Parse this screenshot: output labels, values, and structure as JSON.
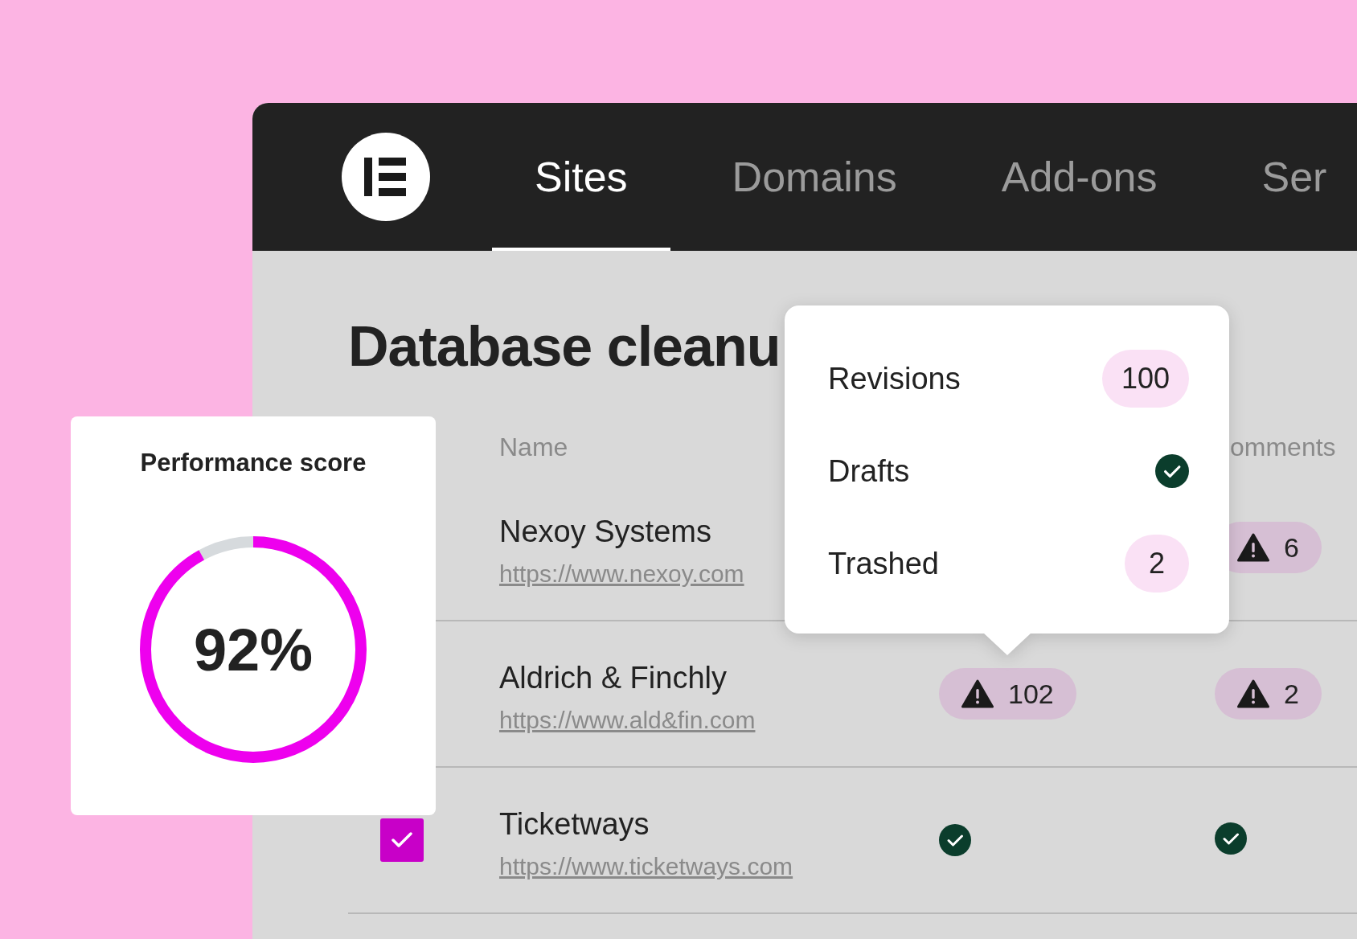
{
  "nav": {
    "tabs": [
      {
        "label": "Sites",
        "selected": true
      },
      {
        "label": "Domains",
        "selected": false
      },
      {
        "label": "Add-ons",
        "selected": false
      },
      {
        "label": "Ser",
        "selected": false
      }
    ]
  },
  "page": {
    "title": "Database cleanu"
  },
  "table": {
    "columns": [
      "Name",
      "omments"
    ],
    "rows": [
      {
        "name": "Nexoy Systems",
        "url": "https://www.nexoy.com",
        "column_3": {
          "kind": "warning",
          "count": "6"
        }
      },
      {
        "name": "Aldrich & Finchly",
        "url": "https://www.ald&fin.com",
        "column_2": {
          "kind": "warning",
          "count": "102"
        },
        "column_3": {
          "kind": "warning",
          "count": "2"
        }
      },
      {
        "name": "Ticketways",
        "url": "https://www.ticketways.com",
        "checked": true,
        "column_2": {
          "kind": "ok"
        },
        "column_3": {
          "kind": "ok"
        }
      }
    ]
  },
  "popover": {
    "items": [
      {
        "label": "Revisions",
        "kind": "count",
        "count": "100"
      },
      {
        "label": "Drafts",
        "kind": "ok"
      },
      {
        "label": "Trashed",
        "kind": "count",
        "count": "2"
      }
    ]
  },
  "performance": {
    "title": "Performance score",
    "value": "92%",
    "level": 0.92
  }
}
